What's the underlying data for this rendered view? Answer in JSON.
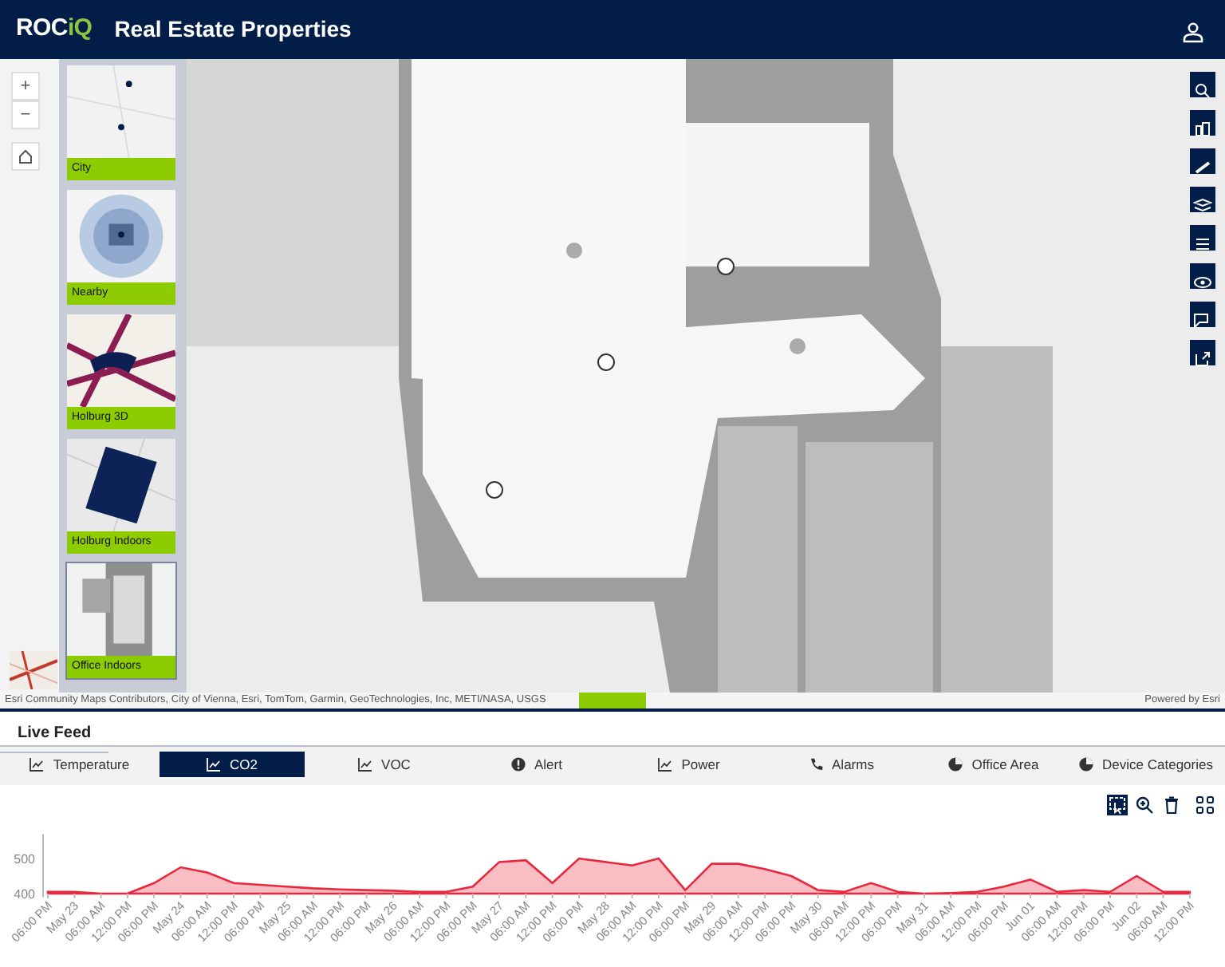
{
  "header": {
    "logo": [
      {
        "text": "ROC",
        "color": "#ffffff"
      },
      {
        "text": "iQ",
        "color": "#8cc63f"
      }
    ],
    "title": "Real Estate Properties"
  },
  "map": {
    "zoom_in": "+",
    "zoom_out": "−",
    "layers": [
      {
        "label": "City",
        "selected": false
      },
      {
        "label": "Nearby",
        "selected": false
      },
      {
        "label": "Holburg 3D",
        "selected": false
      },
      {
        "label": "Holburg Indoors",
        "selected": false
      },
      {
        "label": "Office Indoors",
        "selected": true
      }
    ],
    "attribution": "Esri Community Maps Contributors, City of Vienna, Esri, TomTom, Garmin, GeoTechnologies, Inc, METI/NASA, USGS",
    "powered_by": "Powered by Esri"
  },
  "live_feed": {
    "title": "Live Feed",
    "tabs": [
      {
        "label": "Temperature",
        "kind": "chart",
        "selected": false
      },
      {
        "label": "CO2",
        "kind": "chart",
        "selected": true
      },
      {
        "label": "VOC",
        "kind": "chart",
        "selected": false
      },
      {
        "label": "Alert",
        "kind": "alert",
        "selected": false
      },
      {
        "label": "Power",
        "kind": "chart",
        "selected": false
      },
      {
        "label": "Alarms",
        "kind": "phone",
        "selected": false
      },
      {
        "label": "Office Area",
        "kind": "pie",
        "selected": false
      },
      {
        "label": "Device Categories",
        "kind": "pie",
        "selected": false
      }
    ],
    "chart_data": {
      "type": "area",
      "categories": [
        "06:00 PM",
        "May 23",
        "06:00 AM",
        "12:00 PM",
        "06:00 PM",
        "May 24",
        "06:00 AM",
        "12:00 PM",
        "06:00 PM",
        "May 25",
        "06:00 AM",
        "12:00 PM",
        "06:00 PM",
        "May 26",
        "06:00 AM",
        "12:00 PM",
        "06:00 PM",
        "May 27",
        "06:00 AM",
        "12:00 PM",
        "06:00 PM",
        "May 28",
        "06:00 AM",
        "12:00 PM",
        "06:00 PM",
        "May 29",
        "06:00 AM",
        "12:00 PM",
        "06:00 PM",
        "May 30",
        "06:00 AM",
        "12:00 PM",
        "06:00 PM",
        "May 31",
        "06:00 AM",
        "12:00 PM",
        "06:00 PM",
        "Jun 01",
        "06:00 AM",
        "12:00 PM",
        "06:00 PM",
        "Jun 02",
        "06:00 AM",
        "12:00 PM"
      ],
      "series": [
        {
          "color": "#e8283c",
          "values": [
            405,
            405,
            400,
            400,
            430,
            475,
            460,
            430,
            425,
            420,
            415,
            412,
            410,
            408,
            405,
            405,
            420,
            490,
            495,
            430,
            500,
            490,
            480,
            500,
            410,
            485,
            485,
            470,
            450,
            410,
            405,
            430,
            405,
            400,
            402,
            405,
            420,
            440,
            405,
            410,
            405,
            450,
            405,
            405
          ]
        }
      ],
      "ylim": [
        390,
        570
      ],
      "yticks": [
        400,
        500
      ]
    }
  }
}
